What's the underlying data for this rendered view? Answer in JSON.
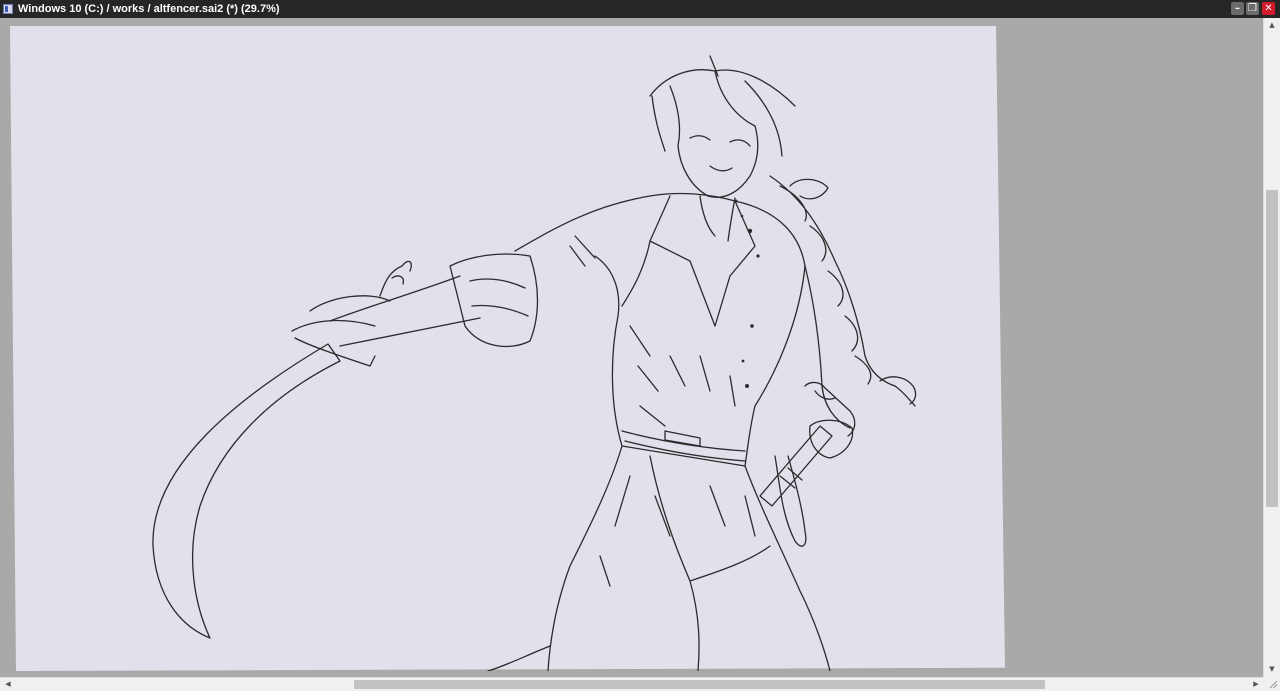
{
  "window": {
    "title": "Windows 10 (C:) / works / altfencer.sai2 (*) (29.7%)",
    "controls": {
      "minimize": "–",
      "restore": "❐",
      "close": "✕"
    }
  },
  "canvas": {
    "document": "altfencer.sai2",
    "zoom": "29.7%",
    "paper_color": "#e2e0ea",
    "background_color": "#a9a9a9",
    "artwork": "line-art-swordsman-with-braid-and-saber"
  },
  "scrollbars": {
    "vertical": {
      "up_arrow": "▲",
      "down_arrow": "▼"
    },
    "horizontal": {
      "left_arrow": "◀",
      "right_arrow": "▶"
    }
  },
  "colors": {
    "titlebar": "#262626",
    "close_button": "#d21c2c",
    "line_art": "#2b2b2b"
  }
}
